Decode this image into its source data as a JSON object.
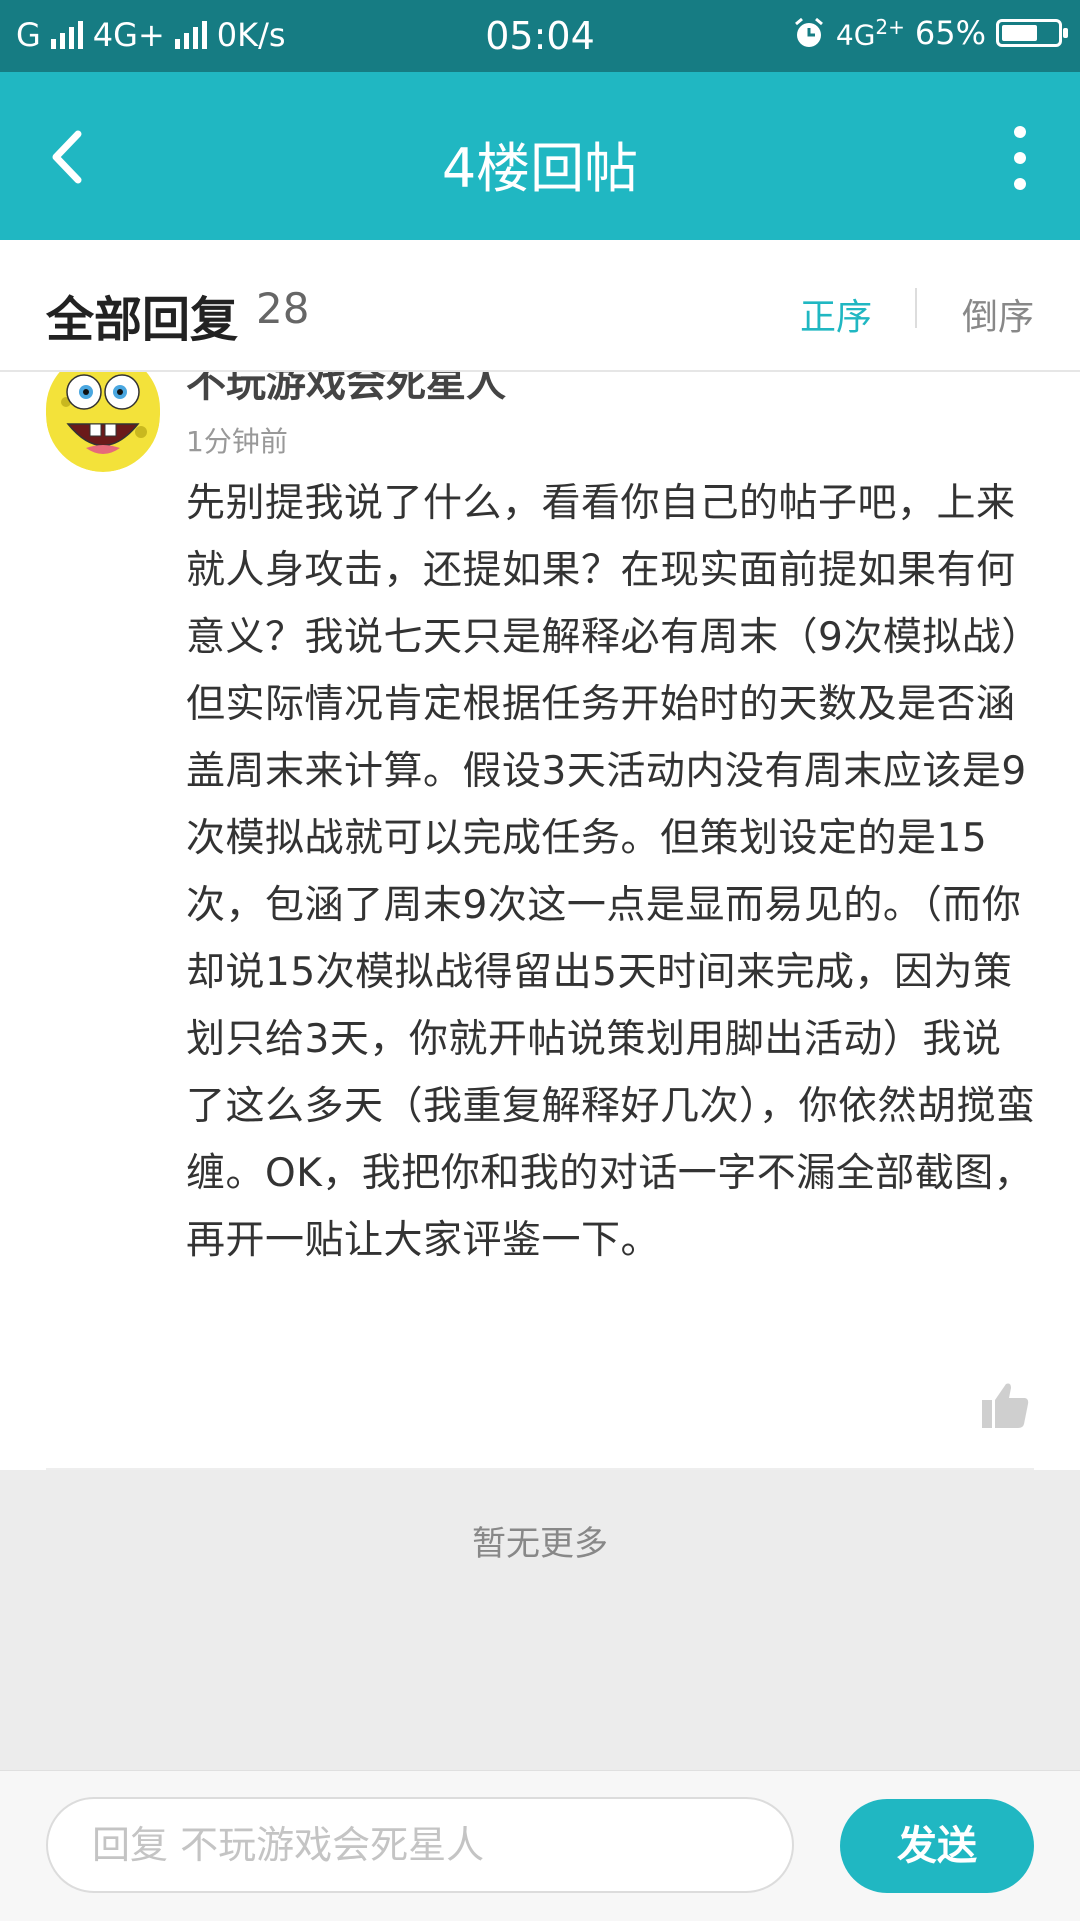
{
  "status_bar": {
    "carrier1": "G",
    "carrier2": "4G+",
    "speed": "0K/s",
    "time": "05:04",
    "network_right": "4G",
    "network_right_sup": "2+",
    "battery": "65%",
    "battery_level": 0.65,
    "icons": [
      "signal-icon",
      "alarm-icon",
      "battery-icon"
    ]
  },
  "header": {
    "title": "4楼回帖",
    "back_icon": "back-chevron-icon",
    "more_icon": "more-vertical-icon",
    "color": "#20b7c2"
  },
  "reply_bar": {
    "label": "全部回复",
    "count": "28",
    "sort_asc": "正序",
    "sort_desc": "倒序",
    "active_sort": "正序"
  },
  "post": {
    "username": "不玩游戏会死星人",
    "time_ago": "1分钟前",
    "content": "先别提我说了什么，看看你自己的帖子吧，上来就人身攻击，还提如果？在现实面前提如果有何意义？我说七天只是解释必有周末（9次模拟战）但实际情况肯定根据任务开始时的天数及是否涵盖周末来计算。假设3天活动内没有周末应该是9次模拟战就可以完成任务。但策划设定的是15次，包涵了周末9次这一点是显而易见的。（而你却说15次模拟战得留出5天时间来完成，因为策划只给3天，你就开帖说策划用脚出活动）我说了这么多天（我重复解释好几次），你依然胡搅蛮缠。OK，我把你和我的对话一字不漏全部截图，再开一贴让大家评鉴一下。",
    "avatar_icon": "spongebob-avatar",
    "like_icon": "thumbs-up-icon"
  },
  "footer_note": "暂无更多",
  "input_bar": {
    "placeholder": "回复 不玩游戏会死星人",
    "send_label": "发送"
  }
}
